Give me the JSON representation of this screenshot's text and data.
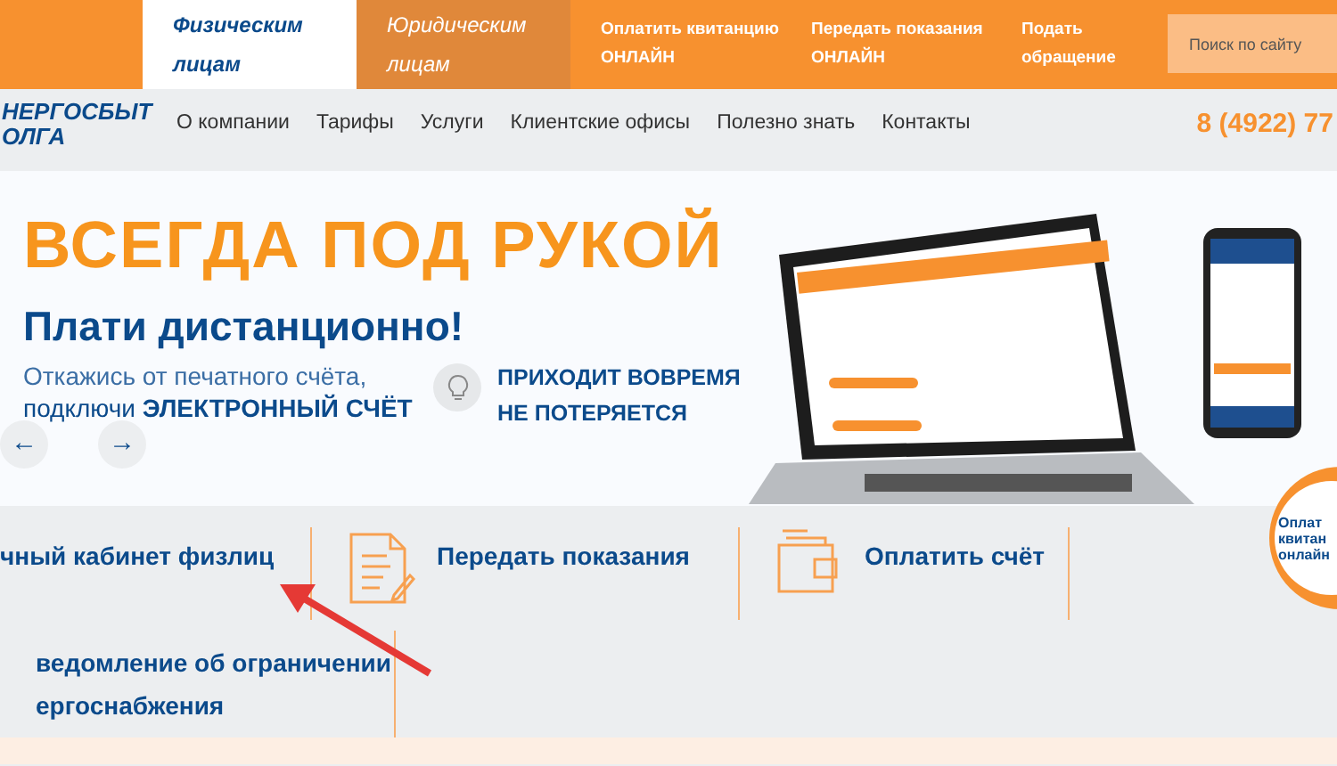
{
  "top_bar": {
    "tabs": [
      {
        "label": "Физическим лицам",
        "selected": true
      },
      {
        "label": "Юридическим лицам",
        "selected": false
      }
    ],
    "links": [
      {
        "line1": "Оплатить квитанцию",
        "line2": "ОНЛАЙН"
      },
      {
        "line1": "Передать показания",
        "line2": "ОНЛАЙН"
      },
      {
        "line1": "Подать",
        "line2": "обращение"
      }
    ],
    "search": {
      "placeholder": "Поиск по сайту"
    }
  },
  "nav": {
    "logo": [
      "НЕРГОСБЫТ",
      "ОЛГА"
    ],
    "items": [
      "О компании",
      "Тарифы",
      "Услуги",
      "Клиентские офисы",
      "Полезно знать",
      "Контакты"
    ],
    "phone": "8 (4922) 77"
  },
  "banner": {
    "headline": "ВСЕГДА ПОД РУКОЙ",
    "subtitle": "Плати дистанционно!",
    "text_line1": "Откажись от печатного счёта,",
    "text_line2": "подключи **ЭЛЕКТРОННЫЙ СЧЁТ**",
    "feature": [
      "ПРИХОДИТ ВОВРЕМЯ",
      "НЕ ПОТЕРЯЕТСЯ"
    ],
    "prev": "←",
    "next": "→"
  },
  "services": [
    {
      "kind": "plain",
      "label": "чный кабинет физлиц"
    },
    {
      "kind": "document",
      "label": "Передать показания"
    },
    {
      "kind": "wallet",
      "label": "Оплатить счёт"
    },
    {
      "kind": "plain",
      "label": "ведомление об ограничении\nергоснабжения"
    }
  ],
  "badge": {
    "lines": [
      "Оплат",
      "квитан",
      "онлайн"
    ]
  }
}
